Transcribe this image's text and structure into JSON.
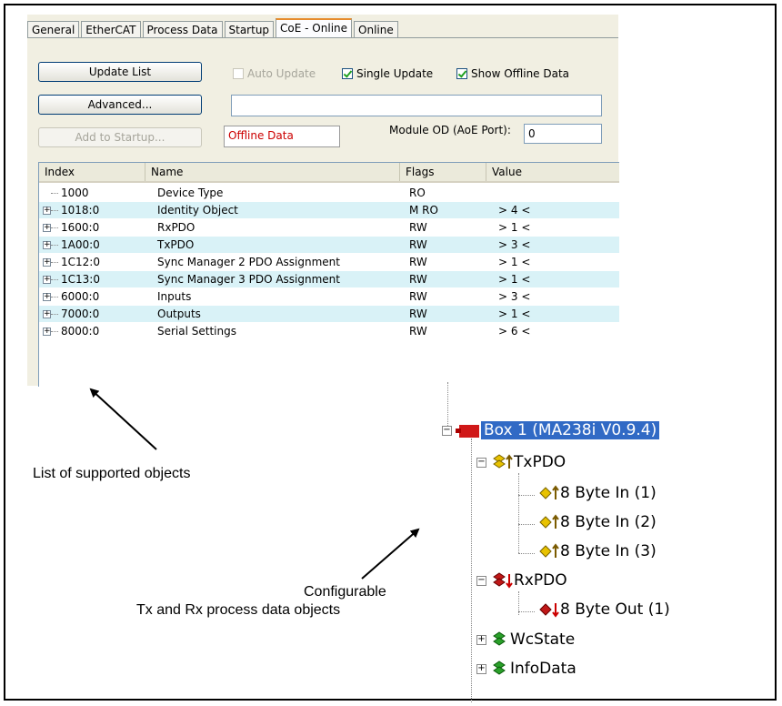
{
  "tabs": [
    "General",
    "EtherCAT",
    "Process Data",
    "Startup",
    "CoE - Online",
    "Online"
  ],
  "active_tab": "CoE - Online",
  "buttons": {
    "update_list": "Update List",
    "advanced": "Advanced...",
    "add_to_startup": "Add to Startup..."
  },
  "checkboxes": {
    "auto_update": {
      "label": "Auto Update",
      "checked": false,
      "enabled": false
    },
    "single_update": {
      "label": "Single Update",
      "checked": true
    },
    "show_offline": {
      "label": "Show Offline Data",
      "checked": true
    }
  },
  "offline_label": "Offline Data",
  "module_od": {
    "label": "Module OD (AoE Port):",
    "value": "0"
  },
  "columns": [
    "Index",
    "Name",
    "Flags",
    "Value"
  ],
  "rows": [
    {
      "index": "1000",
      "name": "Device Type",
      "flags": "RO",
      "value": "",
      "expandable": false
    },
    {
      "index": "1018:0",
      "name": "Identity Object",
      "flags": "M RO",
      "value": "> 4 <",
      "expandable": true
    },
    {
      "index": "1600:0",
      "name": "RxPDO",
      "flags": "RW",
      "value": "> 1 <",
      "expandable": true
    },
    {
      "index": "1A00:0",
      "name": "TxPDO",
      "flags": "RW",
      "value": "> 3 <",
      "expandable": true
    },
    {
      "index": "1C12:0",
      "name": "Sync Manager 2 PDO Assignment",
      "flags": "RW",
      "value": "> 1 <",
      "expandable": true
    },
    {
      "index": "1C13:0",
      "name": "Sync Manager 3 PDO Assignment",
      "flags": "RW",
      "value": "> 1 <",
      "expandable": true
    },
    {
      "index": "6000:0",
      "name": "Inputs",
      "flags": "RW",
      "value": "> 3 <",
      "expandable": true
    },
    {
      "index": "7000:0",
      "name": "Outputs",
      "flags": "RW",
      "value": "> 1 <",
      "expandable": true
    },
    {
      "index": "8000:0",
      "name": "Serial Settings",
      "flags": "RW",
      "value": "> 6 <",
      "expandable": true
    }
  ],
  "annotations": {
    "list_label": "List of supported objects",
    "config_line1": "Configurable",
    "config_line2": "Tx and Rx process data objects"
  },
  "tree": {
    "box": "Box 1 (MA238i V0.9.4)",
    "txpdo": "TxPDO",
    "tx_items": [
      "8 Byte In (1)",
      "8 Byte In (2)",
      "8 Byte In (3)"
    ],
    "rxpdo": "RxPDO",
    "rx_items": [
      "8 Byte Out (1)"
    ],
    "wcstate": "WcState",
    "infodata": "InfoData"
  },
  "colors": {
    "dialog_bg": "#f1efe2",
    "row_alt": "#d9f2f7",
    "selection": "#316ac5",
    "offline_text": "#cc0000"
  }
}
